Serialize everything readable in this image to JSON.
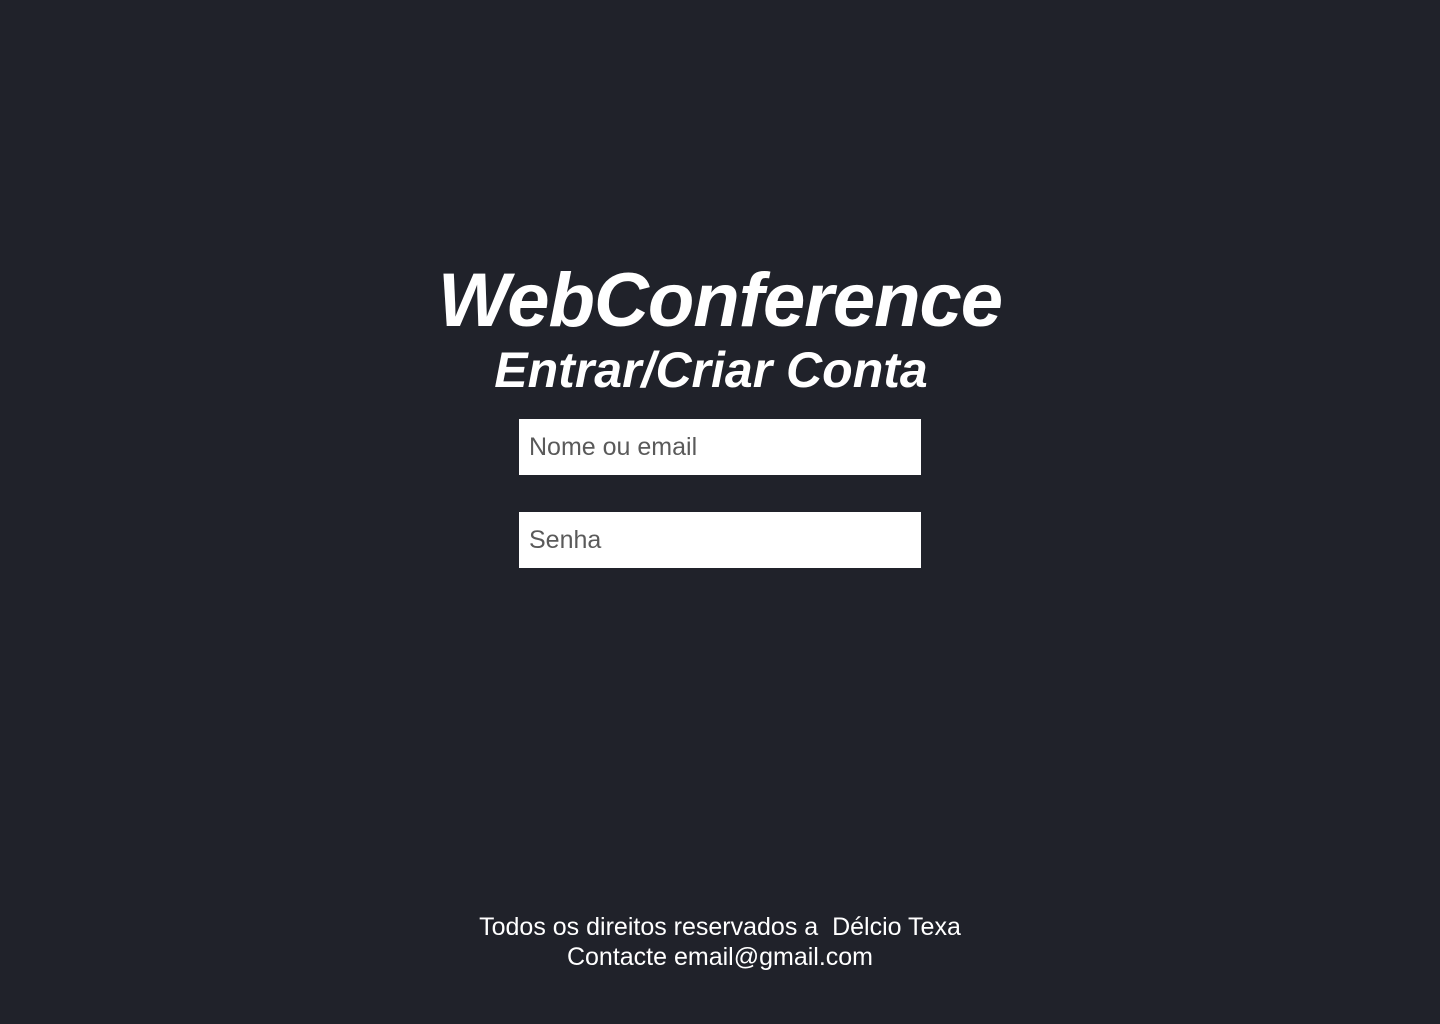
{
  "header": {
    "app_title": "WebConference",
    "subtitle": "Entrar/Criar Conta"
  },
  "login_form": {
    "username": {
      "value": "",
      "placeholder": "Nome ou email"
    },
    "password": {
      "value": "",
      "placeholder": "Senha"
    }
  },
  "footer": {
    "copyright": "Todos os direitos reservados a  Délcio Texa",
    "contact": "Contacte email@gmail.com"
  },
  "colors": {
    "background": "#20222a",
    "text": "#ffffff",
    "input_background": "#ffffff",
    "placeholder": "#5a5a5a"
  }
}
